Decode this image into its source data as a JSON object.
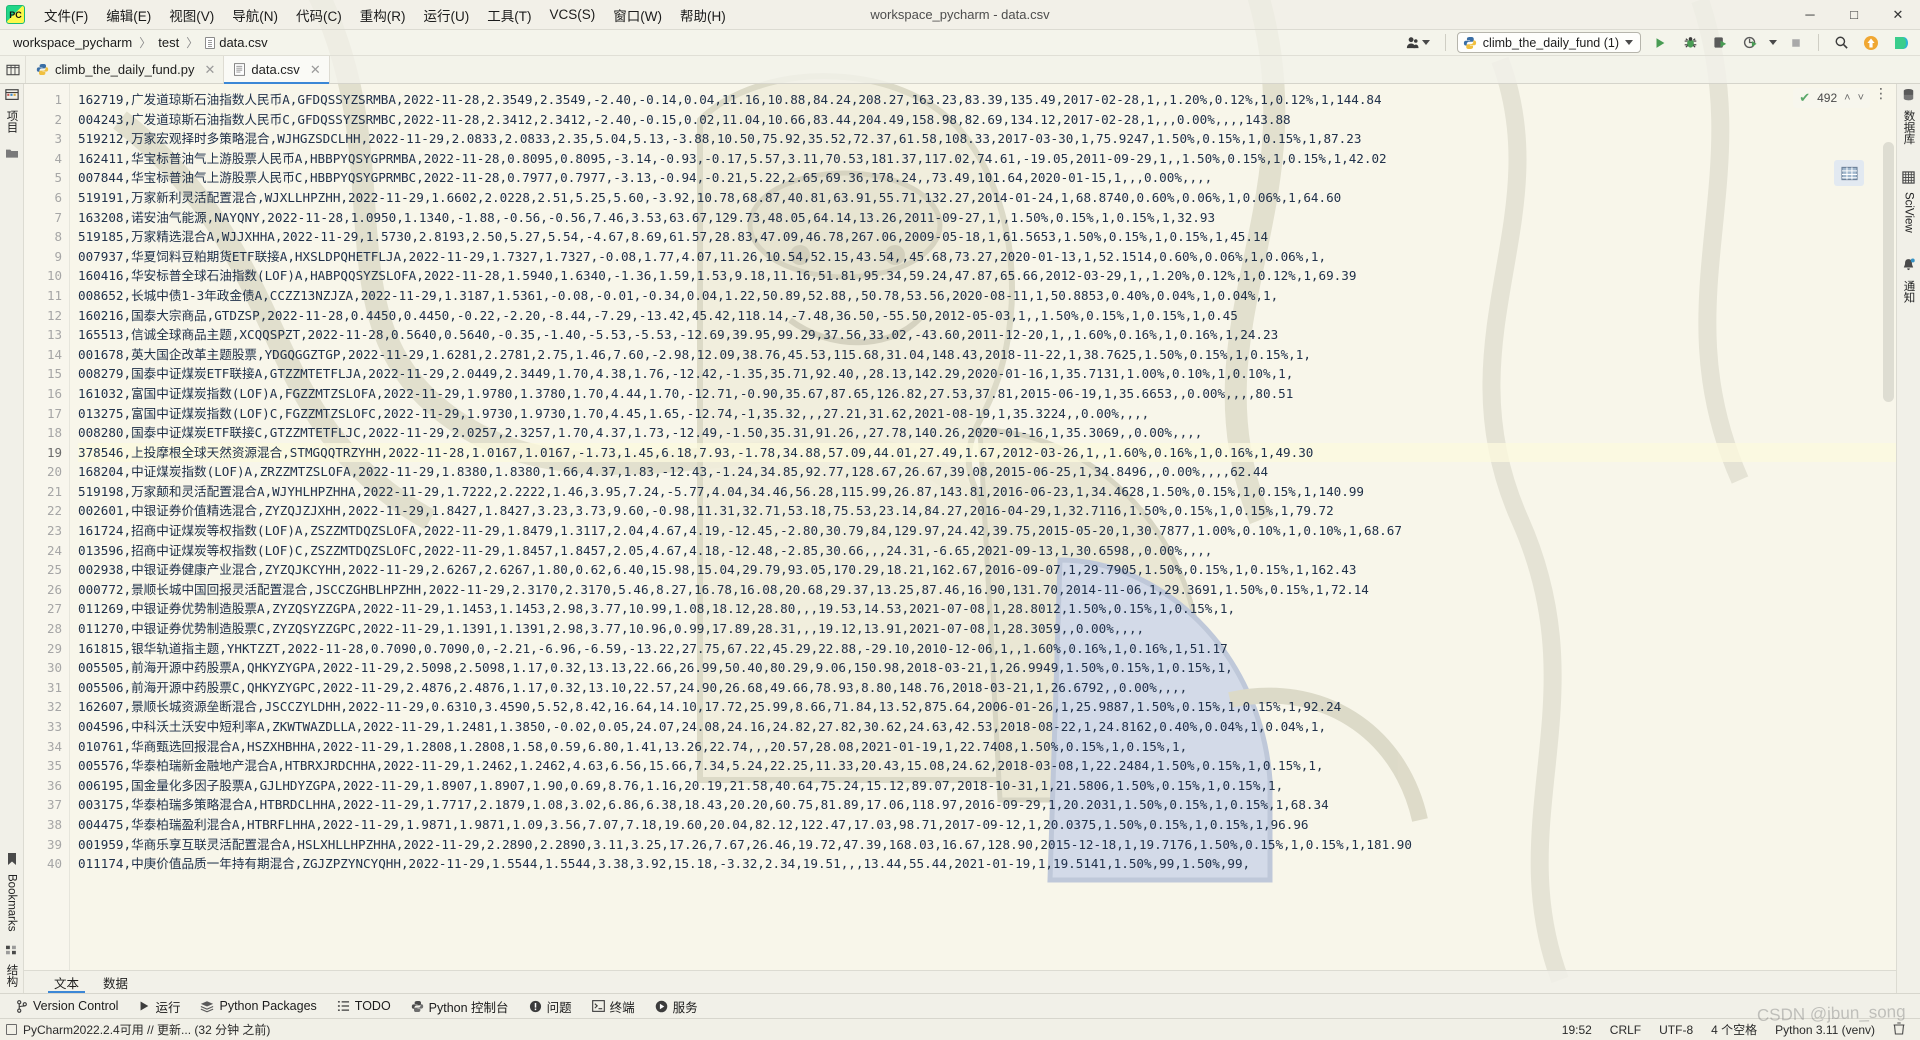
{
  "window": {
    "title": "workspace_pycharm - data.csv",
    "logo_text": "PC",
    "minimize": "─",
    "maximize": "□",
    "close": "✕"
  },
  "menu": {
    "items": [
      {
        "label": "文件(F)",
        "name": "menu-file"
      },
      {
        "label": "编辑(E)",
        "name": "menu-edit"
      },
      {
        "label": "视图(V)",
        "name": "menu-view"
      },
      {
        "label": "导航(N)",
        "name": "menu-navigate"
      },
      {
        "label": "代码(C)",
        "name": "menu-code"
      },
      {
        "label": "重构(R)",
        "name": "menu-refactor"
      },
      {
        "label": "运行(U)",
        "name": "menu-run"
      },
      {
        "label": "工具(T)",
        "name": "menu-tools"
      },
      {
        "label": "VCS(S)",
        "name": "menu-vcs"
      },
      {
        "label": "窗口(W)",
        "name": "menu-window"
      },
      {
        "label": "帮助(H)",
        "name": "menu-help"
      }
    ]
  },
  "breadcrumb": {
    "items": [
      "workspace_pycharm",
      "test",
      "data.csv"
    ],
    "separator": "〉"
  },
  "run_toolbar": {
    "config_name": "climb_the_daily_fund (1)",
    "buttons": [
      {
        "name": "run-button",
        "label": "▶"
      },
      {
        "name": "debug-button",
        "label": "🐞"
      },
      {
        "name": "run-with-coverage-button",
        "label": "▶"
      },
      {
        "name": "profile-button",
        "label": "◔"
      },
      {
        "name": "stop-button",
        "label": "■"
      },
      {
        "name": "search-everywhere-button",
        "label": "🔍"
      },
      {
        "name": "update-project-button",
        "label": "↑"
      },
      {
        "name": "ide-settings-button",
        "label": "▶"
      }
    ]
  },
  "tabs": [
    {
      "label": "climb_the_daily_fund.py",
      "name": "tab-climb-the-daily-fund-py",
      "active": false,
      "icon": "python-file-icon"
    },
    {
      "label": "data.csv",
      "name": "tab-data-csv",
      "active": true,
      "icon": "csv-file-icon"
    }
  ],
  "left_strip": {
    "top": [
      {
        "label": "项目",
        "name": "tool-window-project",
        "icon": "project-icon"
      }
    ],
    "bottom": [
      {
        "label": "Bookmarks",
        "name": "tool-window-bookmarks",
        "icon": "bookmark-icon"
      },
      {
        "label": "结构",
        "name": "tool-window-structure",
        "icon": "structure-icon"
      }
    ]
  },
  "right_strip": {
    "items": [
      {
        "label": "数据库",
        "name": "tool-window-database",
        "icon": "database-icon"
      },
      {
        "label": "SciView",
        "name": "tool-window-sciview",
        "icon": "sciview-icon"
      },
      {
        "label": "通知",
        "name": "tool-window-notifications",
        "icon": "bell-icon"
      }
    ]
  },
  "inspection": {
    "count": "492",
    "check": "✔",
    "up": "˄",
    "down": "˅",
    "kebab": "⋮"
  },
  "editor_bottom_tabs": [
    {
      "label": "文本",
      "name": "editor-tab-text",
      "active": true
    },
    {
      "label": "数据",
      "name": "editor-tab-data",
      "active": false
    }
  ],
  "tool_windows": [
    {
      "label": "Version Control",
      "name": "toolwin-version-control",
      "icon": "branch-icon"
    },
    {
      "label": "运行",
      "name": "toolwin-run",
      "icon": "run-icon"
    },
    {
      "label": "Python Packages",
      "name": "toolwin-python-packages",
      "icon": "packages-icon"
    },
    {
      "label": "TODO",
      "name": "toolwin-todo",
      "icon": "todo-icon"
    },
    {
      "label": "Python 控制台",
      "name": "toolwin-python-console",
      "icon": "python-icon"
    },
    {
      "label": "问题",
      "name": "toolwin-problems",
      "icon": "problems-icon"
    },
    {
      "label": "终端",
      "name": "toolwin-terminal",
      "icon": "terminal-icon"
    },
    {
      "label": "服务",
      "name": "toolwin-services",
      "icon": "services-icon"
    }
  ],
  "status": {
    "message": "PyCharm2022.2.4可用 // 更新... (32 分钟 之前)",
    "caret": "19:52",
    "line_sep": "CRLF",
    "encoding": "UTF-8",
    "indent": "4 个空格",
    "interpreter": "Python 3.11 (venv)"
  },
  "watermark": "CSDN @jbun_song",
  "editor": {
    "current_line": 19,
    "first_line_number": 1,
    "lines": [
      "162719,广发道琼斯石油指数人民币A,GFDQSSYZSRMBA,2022-11-28,2.3549,2.3549,-2.40,-0.14,0.04,11.16,10.88,84.24,208.27,163.23,83.39,135.49,2017-02-28,1,,1.20%,0.12%,1,0.12%,1,144.84",
      "004243,广发道琼斯石油指数人民币C,GFDQSSYZSRMBC,2022-11-28,2.3412,2.3412,-2.40,-0.15,0.02,11.04,10.66,83.44,204.49,158.98,82.69,134.12,2017-02-28,1,,,0.00%,,,,143.88",
      "519212,万家宏观择时多策略混合,WJHGZSDCLHH,2022-11-29,2.0833,2.0833,2.35,5.04,5.13,-3.88,10.50,75.92,35.52,72.37,61.58,108.33,2017-03-30,1,75.9247,1.50%,0.15%,1,0.15%,1,87.23",
      "162411,华宝标普油气上游股票人民币A,HBBPYQSYGPRMBA,2022-11-28,0.8095,0.8095,-3.14,-0.93,-0.17,5.57,3.11,70.53,181.37,117.02,74.61,-19.05,2011-09-29,1,,1.50%,0.15%,1,0.15%,1,42.02",
      "007844,华宝标普油气上游股票人民币C,HBBPYQSYGPRMBC,2022-11-28,0.7977,0.7977,-3.13,-0.94,-0.21,5.22,2.65,69.36,178.24,,73.49,101.64,2020-01-15,1,,,0.00%,,,,",
      "519191,万家新利灵活配置混合,WJXLLHPZHH,2022-11-29,1.6602,2.0228,2.51,5.25,5.60,-3.92,10.78,68.87,40.81,63.91,55.71,132.27,2014-01-24,1,68.8740,0.60%,0.06%,1,0.06%,1,64.60",
      "163208,诺安油气能源,NAYQNY,2022-11-28,1.0950,1.1340,-1.88,-0.56,-0.56,7.46,3.53,63.67,129.73,48.05,64.14,13.26,2011-09-27,1,,1.50%,0.15%,1,0.15%,1,32.93",
      "519185,万家精选混合A,WJJXHHA,2022-11-29,1.5730,2.8193,2.50,5.27,5.54,-4.67,8.69,61.57,28.83,47.09,46.78,267.06,2009-05-18,1,61.5653,1.50%,0.15%,1,0.15%,1,45.14",
      "007937,华夏饲料豆粕期货ETF联接A,HXSLDPQHETFLJA,2022-11-29,1.7327,1.7327,-0.08,1.77,4.07,11.26,10.54,52.15,43.54,,45.68,73.27,2020-01-13,1,52.1514,0.60%,0.06%,1,0.06%,1,",
      "160416,华安标普全球石油指数(LOF)A,HABPQQSYZSLOFA,2022-11-28,1.5940,1.6340,-1.36,1.59,1.53,9.18,11.16,51.81,95.34,59.24,47.87,65.66,2012-03-29,1,,1.20%,0.12%,1,0.12%,1,69.39",
      "008652,长城中债1-3年政金债A,CCZZ13NZJZA,2022-11-29,1.3187,1.5361,-0.08,-0.01,-0.34,0.04,1.22,50.89,52.88,,50.78,53.56,2020-08-11,1,50.8853,0.40%,0.04%,1,0.04%,1,",
      "160216,国泰大宗商品,GTDZSP,2022-11-28,0.4450,0.4450,-0.22,-2.20,-8.44,-7.29,-13.42,45.42,118.14,-7.48,36.50,-55.50,2012-05-03,1,,1.50%,0.15%,1,0.15%,1,0.45",
      "165513,信诚全球商品主题,XCQQSPZT,2022-11-28,0.5640,0.5640,-0.35,-1.40,-5.53,-5.53,-12.69,39.95,99.29,37.56,33.02,-43.60,2011-12-20,1,,1.60%,0.16%,1,0.16%,1,24.23",
      "001678,英大国企改革主题股票,YDGQGGZTGP,2022-11-29,1.6281,2.2781,2.75,1.46,7.60,-2.98,12.09,38.76,45.53,115.68,31.04,148.43,2018-11-22,1,38.7625,1.50%,0.15%,1,0.15%,1,",
      "008279,国泰中证煤炭ETF联接A,GTZZMTETFLJA,2022-11-29,2.0449,2.3449,1.70,4.38,1.76,-12.42,-1.35,35.71,92.40,,28.13,142.29,2020-01-16,1,35.7131,1.00%,0.10%,1,0.10%,1,",
      "161032,富国中证煤炭指数(LOF)A,FGZZMTZSLOFA,2022-11-29,1.9780,1.3780,1.70,4.44,1.70,-12.71,-0.90,35.67,87.65,126.82,27.53,37.81,2015-06-19,1,35.6653,,0.00%,,,,80.51",
      "013275,富国中证煤炭指数(LOF)C,FGZZMTZSLOFC,2022-11-29,1.9730,1.9730,1.70,4.45,1.65,-12.74,-1,35.32,,,27.21,31.62,2021-08-19,1,35.3224,,0.00%,,,,",
      "008280,国泰中证煤炭ETF联接C,GTZZMTETFLJC,2022-11-29,2.0257,2.3257,1.70,4.37,1.73,-12.49,-1.50,35.31,91.26,,27.78,140.26,2020-01-16,1,35.3069,,0.00%,,,,",
      "378546,上投摩根全球天然资源混合,STMGQQTRZYHH,2022-11-28,1.0167,1.0167,-1.73,1.45,6.18,7.93,-1.78,34.88,57.09,44.01,27.49,1.67,2012-03-26,1,,1.60%,0.16%,1,0.16%,1,49.30",
      "168204,中证煤炭指数(LOF)A,ZRZZMTZSLOFA,2022-11-29,1.8380,1.8380,1.66,4.37,1.83,-12.43,-1.24,34.85,92.77,128.67,26.67,39.08,2015-06-25,1,34.8496,,0.00%,,,,62.44",
      "519198,万家颠和灵活配置混合A,WJYHLHPZHHA,2022-11-29,1.7222,2.2222,1.46,3.95,7.24,-5.77,4.04,34.46,56.28,115.99,26.87,143.81,2016-06-23,1,34.4628,1.50%,0.15%,1,0.15%,1,140.99",
      "002601,中银证券价值精选混合,ZYZQJZJXHH,2022-11-29,1.8427,1.8427,3.23,3.73,9.60,-0.98,11.31,32.71,53.18,75.53,23.14,84.27,2016-04-29,1,32.7116,1.50%,0.15%,1,0.15%,1,79.72",
      "161724,招商中证煤炭等权指数(LOF)A,ZSZZMTDQZSLOFA,2022-11-29,1.8479,1.3117,2.04,4.67,4.19,-12.45,-2.80,30.79,84,129.97,24.42,39.75,2015-05-20,1,30.7877,1.00%,0.10%,1,0.10%,1,68.67",
      "013596,招商中证煤炭等权指数(LOF)C,ZSZZMTDQZSLOFC,2022-11-29,1.8457,1.8457,2.05,4.67,4.18,-12.48,-2.85,30.66,,,24.31,-6.65,2021-09-13,1,30.6598,,0.00%,,,,",
      "002938,中银证券健康产业混合,ZYZQJKCYHH,2022-11-29,2.6267,2.6267,1.80,0.62,6.40,15.98,15.04,29.79,93.05,170.29,18.21,162.67,2016-09-07,1,29.7905,1.50%,0.15%,1,0.15%,1,162.43",
      "000772,景顺长城中国回报灵活配置混合,JSCCZGHBLHPZHH,2022-11-29,2.3170,2.3170,5.46,8.27,16.78,16.08,20.68,29.37,13.25,87.46,16.90,131.70,2014-11-06,1,29.3691,1.50%,0.15%,1,72.14",
      "011269,中银证券优势制造股票A,ZYZQSYZZGPA,2022-11-29,1.1453,1.1453,2.98,3.77,10.99,1.08,18.12,28.80,,,19.53,14.53,2021-07-08,1,28.8012,1.50%,0.15%,1,0.15%,1,",
      "011270,中银证券优势制造股票C,ZYZQSYZZGPC,2022-11-29,1.1391,1.1391,2.98,3.77,10.96,0.99,17.89,28.31,,,19.12,13.91,2021-07-08,1,28.3059,,0.00%,,,,",
      "161815,银华轨道指主题,YHKTZZT,2022-11-28,0.7090,0.7090,0,-2.21,-6.96,-6.59,-13.22,27.75,67.22,45.29,22.88,-29.10,2010-12-06,1,,1.60%,0.16%,1,0.16%,1,51.17",
      "005505,前海开源中药股票A,QHKYZYGPA,2022-11-29,2.5098,2.5098,1.17,0.32,13.13,22.66,26.99,50.40,80.29,9.06,150.98,2018-03-21,1,26.9949,1.50%,0.15%,1,0.15%,1,",
      "005506,前海开源中药股票C,QHKYZYGPC,2022-11-29,2.4876,2.4876,1.17,0.32,13.10,22.57,24.90,26.68,49.66,78.93,8.80,148.76,2018-03-21,1,26.6792,,0.00%,,,,",
      "162607,景顺长城资源垒断混合,JSCCZYLDHH,2022-11-29,0.6310,3.4590,5.52,8.42,16.64,14.10,17.72,25.99,8.66,71.84,13.52,875.64,2006-01-26,1,25.9887,1.50%,0.15%,1,0.15%,1,92.24",
      "004596,中科沃土沃安中短利率A,ZKWTWAZDLLA,2022-11-29,1.2481,1.3850,-0.02,0.05,24.07,24.08,24.16,24.82,27.82,30.62,24.63,42.53,2018-08-22,1,24.8162,0.40%,0.04%,1,0.04%,1,",
      "010761,华商甄选回报混合A,HSZXHBHHA,2022-11-29,1.2808,1.2808,1.58,0.59,6.80,1.41,13.26,22.74,,,20.57,28.08,2021-01-19,1,22.7408,1.50%,0.15%,1,0.15%,1,",
      "005576,华泰柏瑞新金融地产混合A,HTBRXJRDCHHA,2022-11-29,1.2462,1.2462,4.63,6.56,15.66,7.34,5.24,22.25,11.33,20.43,15.08,24.62,2018-03-08,1,22.2484,1.50%,0.15%,1,0.15%,1,",
      "006195,国金量化多因子股票A,GJLHDYZGPA,2022-11-29,1.8907,1.8907,1.90,0.69,8.76,1.16,20.19,21.58,40.64,75.24,15.12,89.07,2018-10-31,1,21.5806,1.50%,0.15%,1,0.15%,1,",
      "003175,华泰柏瑞多策略混合A,HTBRDCLHHA,2022-11-29,1.7717,2.1879,1.08,3.02,6.86,6.38,18.43,20.20,60.75,81.89,17.06,118.97,2016-09-29,1,20.2031,1.50%,0.15%,1,0.15%,1,68.34",
      "004475,华泰柏瑞盈利混合A,HTBRFLHHA,2022-11-29,1.9871,1.9871,1.09,3.56,7.07,7.18,19.60,20.04,82.12,122.47,17.03,98.71,2017-09-12,1,20.0375,1.50%,0.15%,1,0.15%,1,96.96",
      "001959,华商乐享互联灵活配置混合A,HSLXHLLHPZHHA,2022-11-29,2.2890,2.2890,3.11,3.25,17.26,7.67,26.46,19.72,47.39,168.03,16.67,128.90,2015-12-18,1,19.7176,1.50%,0.15%,1,0.15%,1,181.90",
      "011174,中庚价值品质一年持有期混合,ZGJZPZYNCYQHH,2022-11-29,1.5544,1.5544,3.38,3.92,15.18,-3.32,2.34,19.51,,,13.44,55.44,2021-01-19,1,19.5141,1.50%,99,1.50%,99,"
    ]
  }
}
